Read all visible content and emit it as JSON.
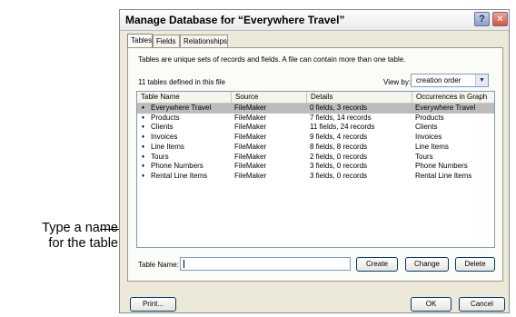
{
  "annotation": {
    "line1": "Type a name",
    "line2": "for the table"
  },
  "window": {
    "title": "Manage Database for “Everywhere Travel”",
    "help_glyph": "?",
    "close_glyph": "×"
  },
  "tabs": [
    {
      "label": "Tables",
      "active": true
    },
    {
      "label": "Fields"
    },
    {
      "label": "Relationships"
    }
  ],
  "panel": {
    "description": "Tables are unique sets of records and fields. A file can contain more than one table.",
    "count_text": "11 tables defined in this file",
    "view_by_label": "View by:",
    "view_by_value": "creation order",
    "arrow_glyph": "▼"
  },
  "table": {
    "columns": [
      "Table Name",
      "Source",
      "Details",
      "Occurrences in Graph"
    ],
    "bullet": "♦",
    "rows": [
      {
        "name": "Everywhere Travel",
        "source": "FileMaker",
        "details": "0 fields, 3 records",
        "occurrences": "Everywhere Travel",
        "selected": true
      },
      {
        "name": "Products",
        "source": "FileMaker",
        "details": "7 fields, 14 records",
        "occurrences": "Products"
      },
      {
        "name": "Clients",
        "source": "FileMaker",
        "details": "11 fields, 24 records",
        "occurrences": "Clients"
      },
      {
        "name": "Invoices",
        "source": "FileMaker",
        "details": "9 fields, 4 records",
        "occurrences": "Invoices"
      },
      {
        "name": "Line Items",
        "source": "FileMaker",
        "details": "8 fields, 8 records",
        "occurrences": "Line Items"
      },
      {
        "name": "Tours",
        "source": "FileMaker",
        "details": "2 fields, 0 records",
        "occurrences": "Tours"
      },
      {
        "name": "Phone Numbers",
        "source": "FileMaker",
        "details": "3 fields, 0 records",
        "occurrences": "Phone Numbers"
      },
      {
        "name": "Rental Line Items",
        "source": "FileMaker",
        "details": "3 fields, 0 records",
        "occurrences": "Rental Line Items"
      }
    ]
  },
  "form": {
    "table_name_label": "Table Name:",
    "table_name_value": "",
    "create": "Create",
    "change": "Change",
    "delete": "Delete"
  },
  "footer": {
    "print": "Print...",
    "ok": "OK",
    "cancel": "Cancel"
  }
}
